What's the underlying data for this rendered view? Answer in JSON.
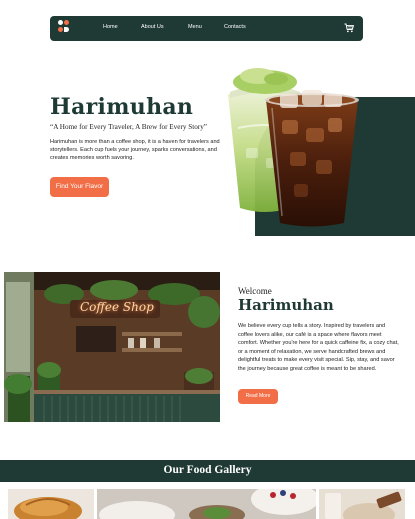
{
  "nav": {
    "links": [
      "Home",
      "About Us",
      "Menu",
      "Contacts"
    ],
    "icons": {
      "logo": "coffee-brand-logo",
      "cart": "cart-icon"
    }
  },
  "hero": {
    "title": "Harimuhan",
    "tagline": "“A Home for Every Traveler, A Brew for Every Story”",
    "description": "Harimuhan is more than a coffee shop, it is a haven for travelers and storytellers. Each cup fuels your journey, sparks conversations, and creates memories worth savoring.",
    "button": "Find Your Flavor"
  },
  "welcome": {
    "small": "Welcome",
    "title": "Harimuhan",
    "description": "We believe every cup tells a story. Inspired by travelers and coffee lovers alike, our café is a space where flavors meet comfort. Whether you're here for a quick caffeine fix, a cozy chat, or a moment of relaxation, we serve handcrafted brews and delightful treats to make every visit special. Sip, stay, and savor the journey because great coffee is meant to be shared.",
    "button": "Read More",
    "sign": "Coffee Shop"
  },
  "gallery": {
    "title": "Our Food Gallery"
  },
  "colors": {
    "brand": "#1f3a34",
    "accent": "#f26e47",
    "matcha": "#9cc35a",
    "coffee": "#4a1e0c"
  }
}
